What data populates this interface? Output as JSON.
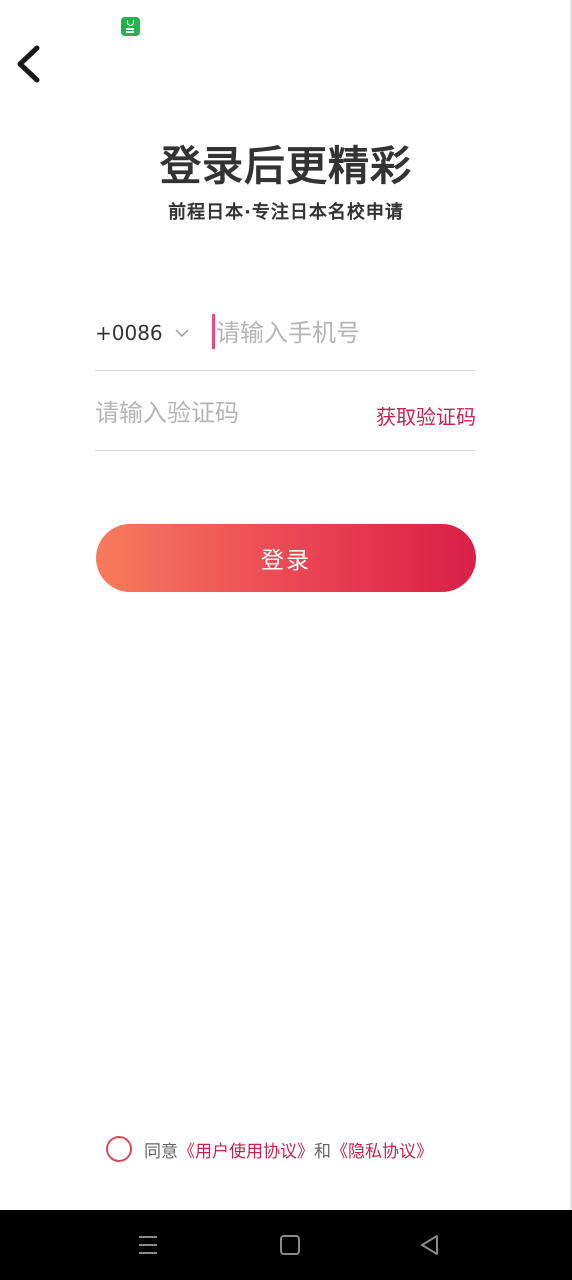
{
  "app": {
    "title": "登录后更精彩",
    "subtitle": "前程日本·专注日本名校申请"
  },
  "status_bar": {
    "app_icon": "green-app-icon"
  },
  "header": {
    "back_icon": "back-chevron-icon"
  },
  "form": {
    "country_code": "+0086",
    "country_code_icon": "chevron-down-icon",
    "phone": {
      "value": "",
      "placeholder": "请输入手机号"
    },
    "code": {
      "value": "",
      "placeholder": "请输入验证码"
    },
    "get_code_label": "获取验证码"
  },
  "login": {
    "label": "登录"
  },
  "agreement": {
    "checked": false,
    "prefix": "同意",
    "user_agreement": "《用户使用协议》",
    "conjunction": "和",
    "privacy_policy": "《隐私协议》"
  },
  "nav_bar": {
    "icons": [
      "menu-icon",
      "home-square-icon",
      "back-triangle-icon"
    ]
  },
  "colors": {
    "accent": "#c8234e",
    "gradient_start": "#f77b5c",
    "gradient_end": "#d91f47",
    "title": "#333333",
    "placeholder": "#b5b5b5"
  }
}
